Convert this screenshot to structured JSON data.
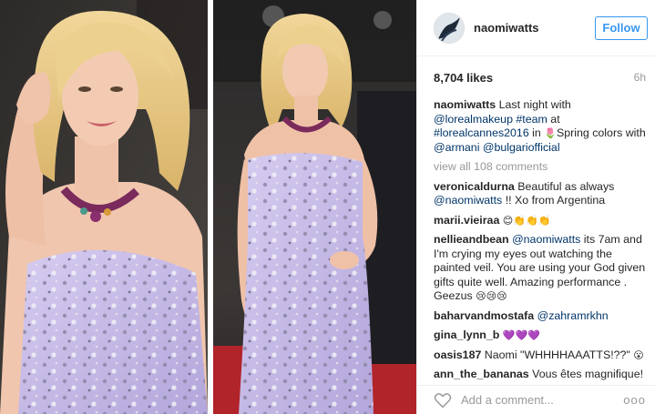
{
  "header": {
    "username": "naomiwatts",
    "follow_label": "Follow"
  },
  "meta": {
    "likes": "8,704 likes",
    "time": "6h"
  },
  "caption": {
    "user": "naomiwatts",
    "t1": " Last night with ",
    "m1": "@lorealmakeup",
    "h1": " #team",
    "t2": " at ",
    "h2": "#lorealcannes2016",
    "t3": " in ",
    "emoji": "🌷",
    "t4": "Spring colors with ",
    "m2": "@armani",
    "m3": " @bulgariofficial"
  },
  "view_all": "view all 108 comments",
  "comments": [
    {
      "user": "veronicaldurna",
      "mention": "",
      "text": " Beautiful as always ",
      "mention2": "@naomiwatts",
      "text2": " !! Xo from Argentina",
      "emoji": ""
    },
    {
      "user": "marii.vieiraa",
      "mention": "",
      "text": " ",
      "mention2": "",
      "text2": "",
      "emoji": "😊👏👏👏"
    },
    {
      "user": "nellieandbean",
      "mention": " @naomiwatts",
      "text": " its 7am and I'm crying my eyes out watching the painted veil. You are using your God given gifts quite well. Amazing performance . Geezus ",
      "mention2": "",
      "text2": "",
      "emoji": "😢😢😢"
    },
    {
      "user": "baharvandmostafa",
      "mention": " @zahramrkhn",
      "text": "",
      "mention2": "",
      "text2": "",
      "emoji": ""
    },
    {
      "user": "gina_lynn_b",
      "mention": "",
      "text": " ",
      "mention2": "",
      "text2": "",
      "emoji": "💜💜💜"
    },
    {
      "user": "oasis187",
      "mention": "",
      "text": " Naomi \"WHHHHAAATTS!??\" ",
      "mention2": "",
      "text2": "",
      "emoji": "😮"
    },
    {
      "user": "ann_the_bananas",
      "mention": "",
      "text": " Vous êtes magnifique!",
      "mention2": "",
      "text2": "",
      "emoji": ""
    }
  ],
  "footer": {
    "add_comment_placeholder": "Add a comment...",
    "more_label": "ooo"
  },
  "colors": {
    "follow_blue": "#3897f0",
    "link_blue": "#003569",
    "dress_lavender": "#c8bde6",
    "carpet_red": "#b0242a"
  }
}
